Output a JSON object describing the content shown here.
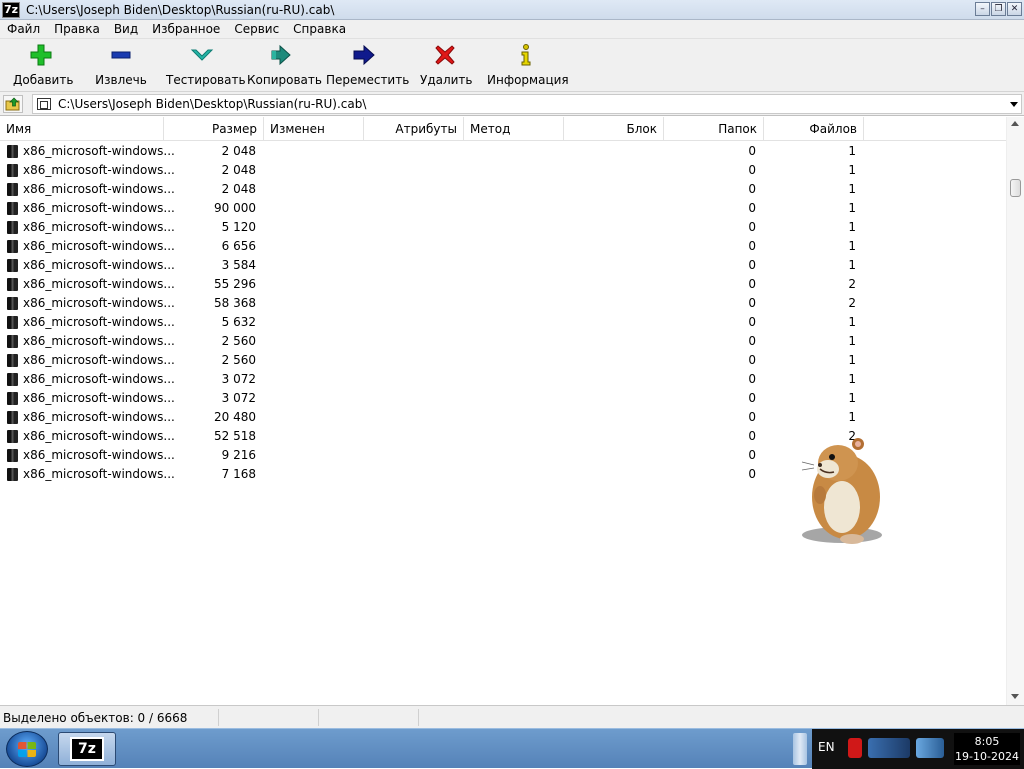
{
  "window": {
    "app_icon_text": "7z",
    "title": "C:\\Users\\Joseph Biden\\Desktop\\Russian(ru-RU).cab\\",
    "controls": [
      "minimize",
      "restore",
      "close"
    ]
  },
  "menu": [
    "Файл",
    "Правка",
    "Вид",
    "Избранное",
    "Сервис",
    "Справка"
  ],
  "toolbar": [
    {
      "label": "Добавить",
      "icon": "plus-icon",
      "color": "#1fbf2a"
    },
    {
      "label": "Извлечь",
      "icon": "minus-icon",
      "color": "#1a3bb0"
    },
    {
      "label": "Тестировать",
      "icon": "check-icon",
      "color": "#26b6a8"
    },
    {
      "label": "Копировать",
      "icon": "double-arrow-icon",
      "color": "#1d8a7b"
    },
    {
      "label": "Переместить",
      "icon": "arrow-right-icon",
      "color": "#101a8c"
    },
    {
      "label": "Удалить",
      "icon": "x-icon",
      "color": "#e01818"
    },
    {
      "label": "Информация",
      "icon": "info-icon",
      "color": "#d7c400"
    }
  ],
  "address": {
    "path": "C:\\Users\\Joseph Biden\\Desktop\\Russian(ru-RU).cab\\"
  },
  "columns": [
    "Имя",
    "Размер",
    "Изменен",
    "Атрибуты",
    "Метод",
    "Блок",
    "Папок",
    "Файлов"
  ],
  "rows": [
    {
      "name": "x86_microsoft-windows...",
      "size": "2 048",
      "folders": "0",
      "files": "1"
    },
    {
      "name": "x86_microsoft-windows...",
      "size": "2 048",
      "folders": "0",
      "files": "1"
    },
    {
      "name": "x86_microsoft-windows...",
      "size": "2 048",
      "folders": "0",
      "files": "1"
    },
    {
      "name": "x86_microsoft-windows...",
      "size": "90 000",
      "folders": "0",
      "files": "1"
    },
    {
      "name": "x86_microsoft-windows...",
      "size": "5 120",
      "folders": "0",
      "files": "1"
    },
    {
      "name": "x86_microsoft-windows...",
      "size": "6 656",
      "folders": "0",
      "files": "1"
    },
    {
      "name": "x86_microsoft-windows...",
      "size": "3 584",
      "folders": "0",
      "files": "1"
    },
    {
      "name": "x86_microsoft-windows...",
      "size": "55 296",
      "folders": "0",
      "files": "2"
    },
    {
      "name": "x86_microsoft-windows...",
      "size": "58 368",
      "folders": "0",
      "files": "2"
    },
    {
      "name": "x86_microsoft-windows...",
      "size": "5 632",
      "folders": "0",
      "files": "1"
    },
    {
      "name": "x86_microsoft-windows...",
      "size": "2 560",
      "folders": "0",
      "files": "1"
    },
    {
      "name": "x86_microsoft-windows...",
      "size": "2 560",
      "folders": "0",
      "files": "1"
    },
    {
      "name": "x86_microsoft-windows...",
      "size": "3 072",
      "folders": "0",
      "files": "1"
    },
    {
      "name": "x86_microsoft-windows...",
      "size": "3 072",
      "folders": "0",
      "files": "1"
    },
    {
      "name": "x86_microsoft-windows...",
      "size": "20 480",
      "folders": "0",
      "files": "1"
    },
    {
      "name": "x86_microsoft-windows...",
      "size": "52 518",
      "folders": "0",
      "files": "2"
    },
    {
      "name": "x86_microsoft-windows...",
      "size": "9 216",
      "folders": "0",
      "files": ""
    },
    {
      "name": "x86_microsoft-windows...",
      "size": "7 168",
      "folders": "0",
      "files": ""
    }
  ],
  "status": {
    "selected": "Выделено объектов: 0 / 6668"
  },
  "overlay": {
    "icon": "hamster-icon"
  },
  "taskbar": {
    "task_app_text": "7z",
    "language": "EN",
    "time": "8:05",
    "date": "19-10-2024"
  }
}
